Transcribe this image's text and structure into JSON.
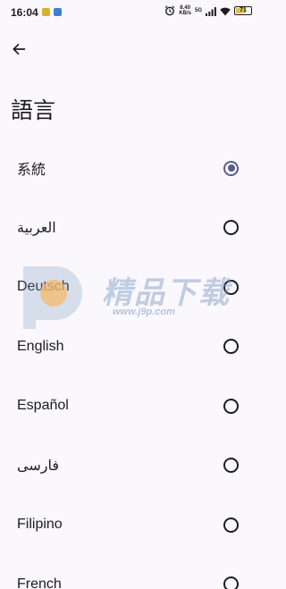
{
  "status_bar": {
    "time": "16:04",
    "net_speed_value": "8.40",
    "net_speed_unit": "KB/s",
    "network_type": "5G",
    "battery_level": "71",
    "battery_fraction": 0.71
  },
  "header": {
    "title": "語言"
  },
  "languages": [
    {
      "label": "系統",
      "selected": true
    },
    {
      "label": "العربية",
      "selected": false
    },
    {
      "label": "Deutsch",
      "selected": false
    },
    {
      "label": "English",
      "selected": false
    },
    {
      "label": "Español",
      "selected": false
    },
    {
      "label": "فارسی",
      "selected": false
    },
    {
      "label": "Filipino",
      "selected": false
    },
    {
      "label": "French",
      "selected": false
    }
  ],
  "watermark": {
    "text": "精品下载",
    "url": "www.j9p.com"
  },
  "colors": {
    "background": "#fbf8fd",
    "text": "#1c1b1f",
    "radio_selected": "#5a5a8a",
    "battery": "#e3c04a",
    "watermark_blue": "#7896be",
    "watermark_orange": "#f5b96a"
  },
  "icons": {
    "back": "arrow-left-icon",
    "alarm": "alarm-icon",
    "signal": "signal-icon",
    "wifi": "wifi-icon"
  }
}
